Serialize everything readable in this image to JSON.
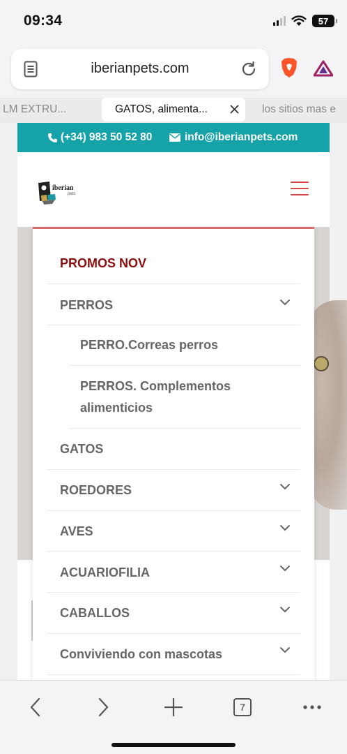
{
  "status_bar": {
    "time": "09:34",
    "battery": "57"
  },
  "browser": {
    "url": "iberianpets.com",
    "tabs": [
      {
        "title": "LM EXTRU..."
      },
      {
        "title": "GATOS, alimenta...",
        "active": true
      },
      {
        "title": "los sitios mas e"
      }
    ],
    "tab_count": "7"
  },
  "site": {
    "phone": "(+34) 983 50 52 80",
    "email": "info@iberianpets.com",
    "logo_text": "iberian",
    "logo_sub": "pets",
    "menu": [
      {
        "label": "PROMOS NOV",
        "highlight": true,
        "expandable": false
      },
      {
        "label": "PERROS",
        "expandable": true
      },
      {
        "label": "PERRO.Correas perros",
        "sub": true,
        "expandable": false
      },
      {
        "label_line1": "PERROS. Complementos",
        "label_line2": "alimenticios",
        "sub": true,
        "expandable": false
      },
      {
        "label": "GATOS",
        "expandable": false
      },
      {
        "label": "ROEDORES",
        "expandable": true
      },
      {
        "label": "AVES",
        "expandable": true
      },
      {
        "label": "ACUARIOFILIA",
        "expandable": true
      },
      {
        "label": "CABALLOS",
        "expandable": true
      },
      {
        "label": "Conviviendo con mascotas",
        "expandable": true
      }
    ]
  },
  "colors": {
    "accent_teal": "#15a2a8",
    "promo_red": "#8b0e0e",
    "menu_border": "#d66a6c",
    "hamburger": "#d9464a"
  },
  "icons": [
    "page-icon",
    "reload-icon",
    "brave-icon",
    "bat-icon",
    "close-icon",
    "phone-icon",
    "mail-icon",
    "hamburger-icon",
    "chevron-down-icon",
    "back-icon",
    "forward-icon",
    "plus-icon",
    "tabs-icon",
    "more-icon"
  ]
}
